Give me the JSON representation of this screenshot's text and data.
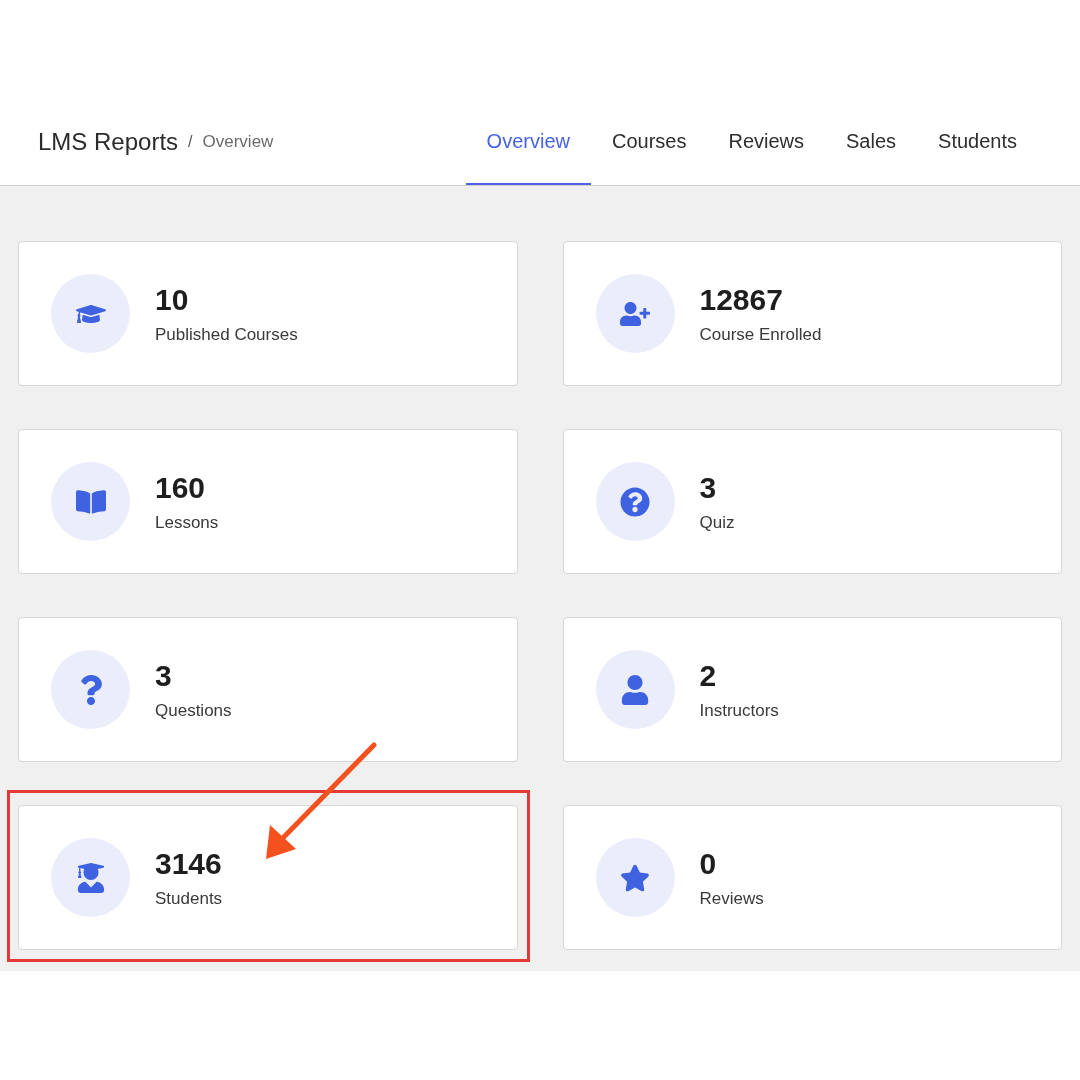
{
  "header": {
    "title": "LMS Reports",
    "separator": "/",
    "crumb": "Overview"
  },
  "tabs": [
    {
      "label": "Overview",
      "selected": true
    },
    {
      "label": "Courses",
      "selected": false
    },
    {
      "label": "Reviews",
      "selected": false
    },
    {
      "label": "Sales",
      "selected": false
    },
    {
      "label": "Students",
      "selected": false
    }
  ],
  "stats": [
    {
      "value": "10",
      "label": "Published Courses",
      "highlighted": false
    },
    {
      "value": "12867",
      "label": "Course Enrolled",
      "highlighted": false
    },
    {
      "value": "160",
      "label": "Lessons",
      "highlighted": false
    },
    {
      "value": "3",
      "label": "Quiz",
      "highlighted": false
    },
    {
      "value": "3",
      "label": "Questions",
      "highlighted": false
    },
    {
      "value": "2",
      "label": "Instructors",
      "highlighted": false
    },
    {
      "value": "3146",
      "label": "Students",
      "highlighted": true
    },
    {
      "value": "0",
      "label": "Reviews",
      "highlighted": false
    }
  ]
}
